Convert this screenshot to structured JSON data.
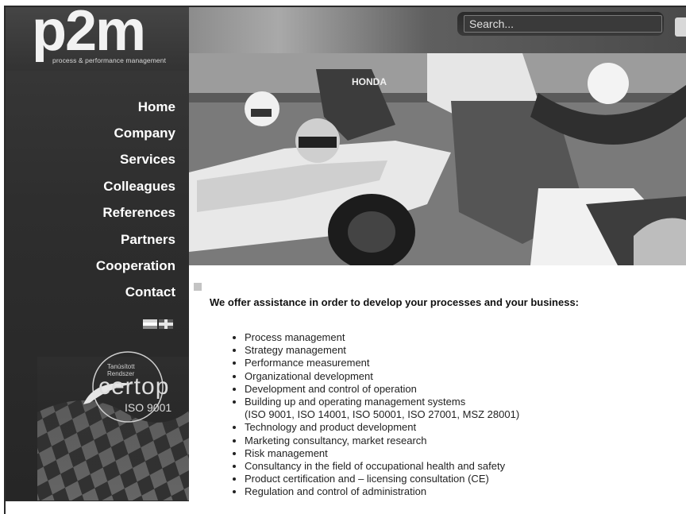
{
  "logo": {
    "mark": "p2m",
    "tagline": "process & performance management"
  },
  "search": {
    "placeholder": "Search..."
  },
  "nav": {
    "items": [
      {
        "label": "Home"
      },
      {
        "label": "Company"
      },
      {
        "label": "Services"
      },
      {
        "label": "Colleagues"
      },
      {
        "label": "References"
      },
      {
        "label": "Partners"
      },
      {
        "label": "Cooperation"
      },
      {
        "label": "Contact"
      }
    ]
  },
  "languages": [
    {
      "icon": "hungarian-flag-icon"
    },
    {
      "icon": "uk-flag-icon"
    }
  ],
  "certificate": {
    "line1": "Tanúsított",
    "line2": "Rendszer",
    "brand": "certop",
    "standard": "ISO 9001"
  },
  "main": {
    "headline": "We offer assistance in order to develop your processes and your business:",
    "services": [
      "Process management",
      "Strategy management",
      "Performance measurement",
      "Organizational development",
      "Development and control of operation",
      "Building up and operating management systems",
      "Technology and product development",
      "Marketing consultancy, market research",
      "Risk management",
      "Consultancy in the field of occupational health and safety",
      "Product certification and – licensing consultation (CE)",
      "Regulation and control of administration"
    ],
    "services_detail": "(ISO 9001, ISO 14001, ISO 50001, ISO 27001, MSZ 28001)"
  },
  "colors": {
    "sidebar": "#2e2e2e",
    "text": "#111111",
    "marker": "#c4c4c4"
  }
}
